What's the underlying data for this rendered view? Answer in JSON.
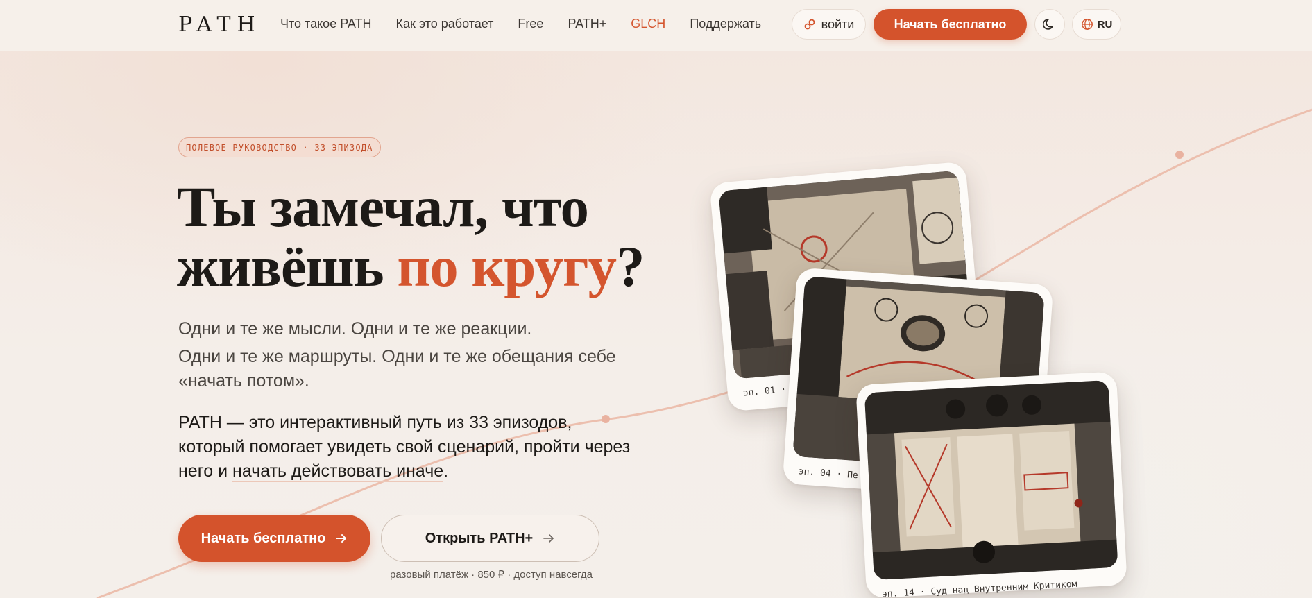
{
  "nav": {
    "logo": "PATH",
    "links": [
      "Что такое PATH",
      "Как это работает",
      "Free",
      "PATH+",
      "GLCH",
      "Поддержать"
    ],
    "login_label": "войти",
    "cta_label": "Начать бесплатно",
    "language": "RU"
  },
  "hero": {
    "badge": "ПОЛЕВОЕ РУКОВОДСТВО · 33 ЭПИЗОДА",
    "headline_line1": "Ты замечал, что",
    "headline_line2_start": "живёшь ",
    "headline_accent": "по кругу",
    "headline_end": "?",
    "sub_line1": "Одни и те же мысли. Одни и те же реакции.",
    "sub_line2": "Одни и те же маршруты. Одни и те же обещания себе «начать потом».",
    "desc_start": "PATH — это интерактивный путь из 33 эпизодов, который помогает увидеть свой сценарий, пройти через него и ",
    "desc_highlight": "начать действовать иначе",
    "desc_end": ".",
    "cta_main": "Начать бесплатно",
    "cta_plus": "Открыть PATH+",
    "price_note": "разовый платёж · 850 ₽ · доступ навсегда"
  },
  "cards": [
    {
      "caption": "эп. 01 · "
    },
    {
      "caption": "эп. 04 · Пе"
    },
    {
      "caption": "эп. 14 · Суд над Внутренним Критиком"
    }
  ],
  "colors": {
    "accent": "#d4532c",
    "background": "#f4ece6",
    "text": "#1d1a17"
  },
  "icons": [
    "login-icon",
    "moon-icon",
    "globe-icon",
    "arrow-right-icon"
  ]
}
